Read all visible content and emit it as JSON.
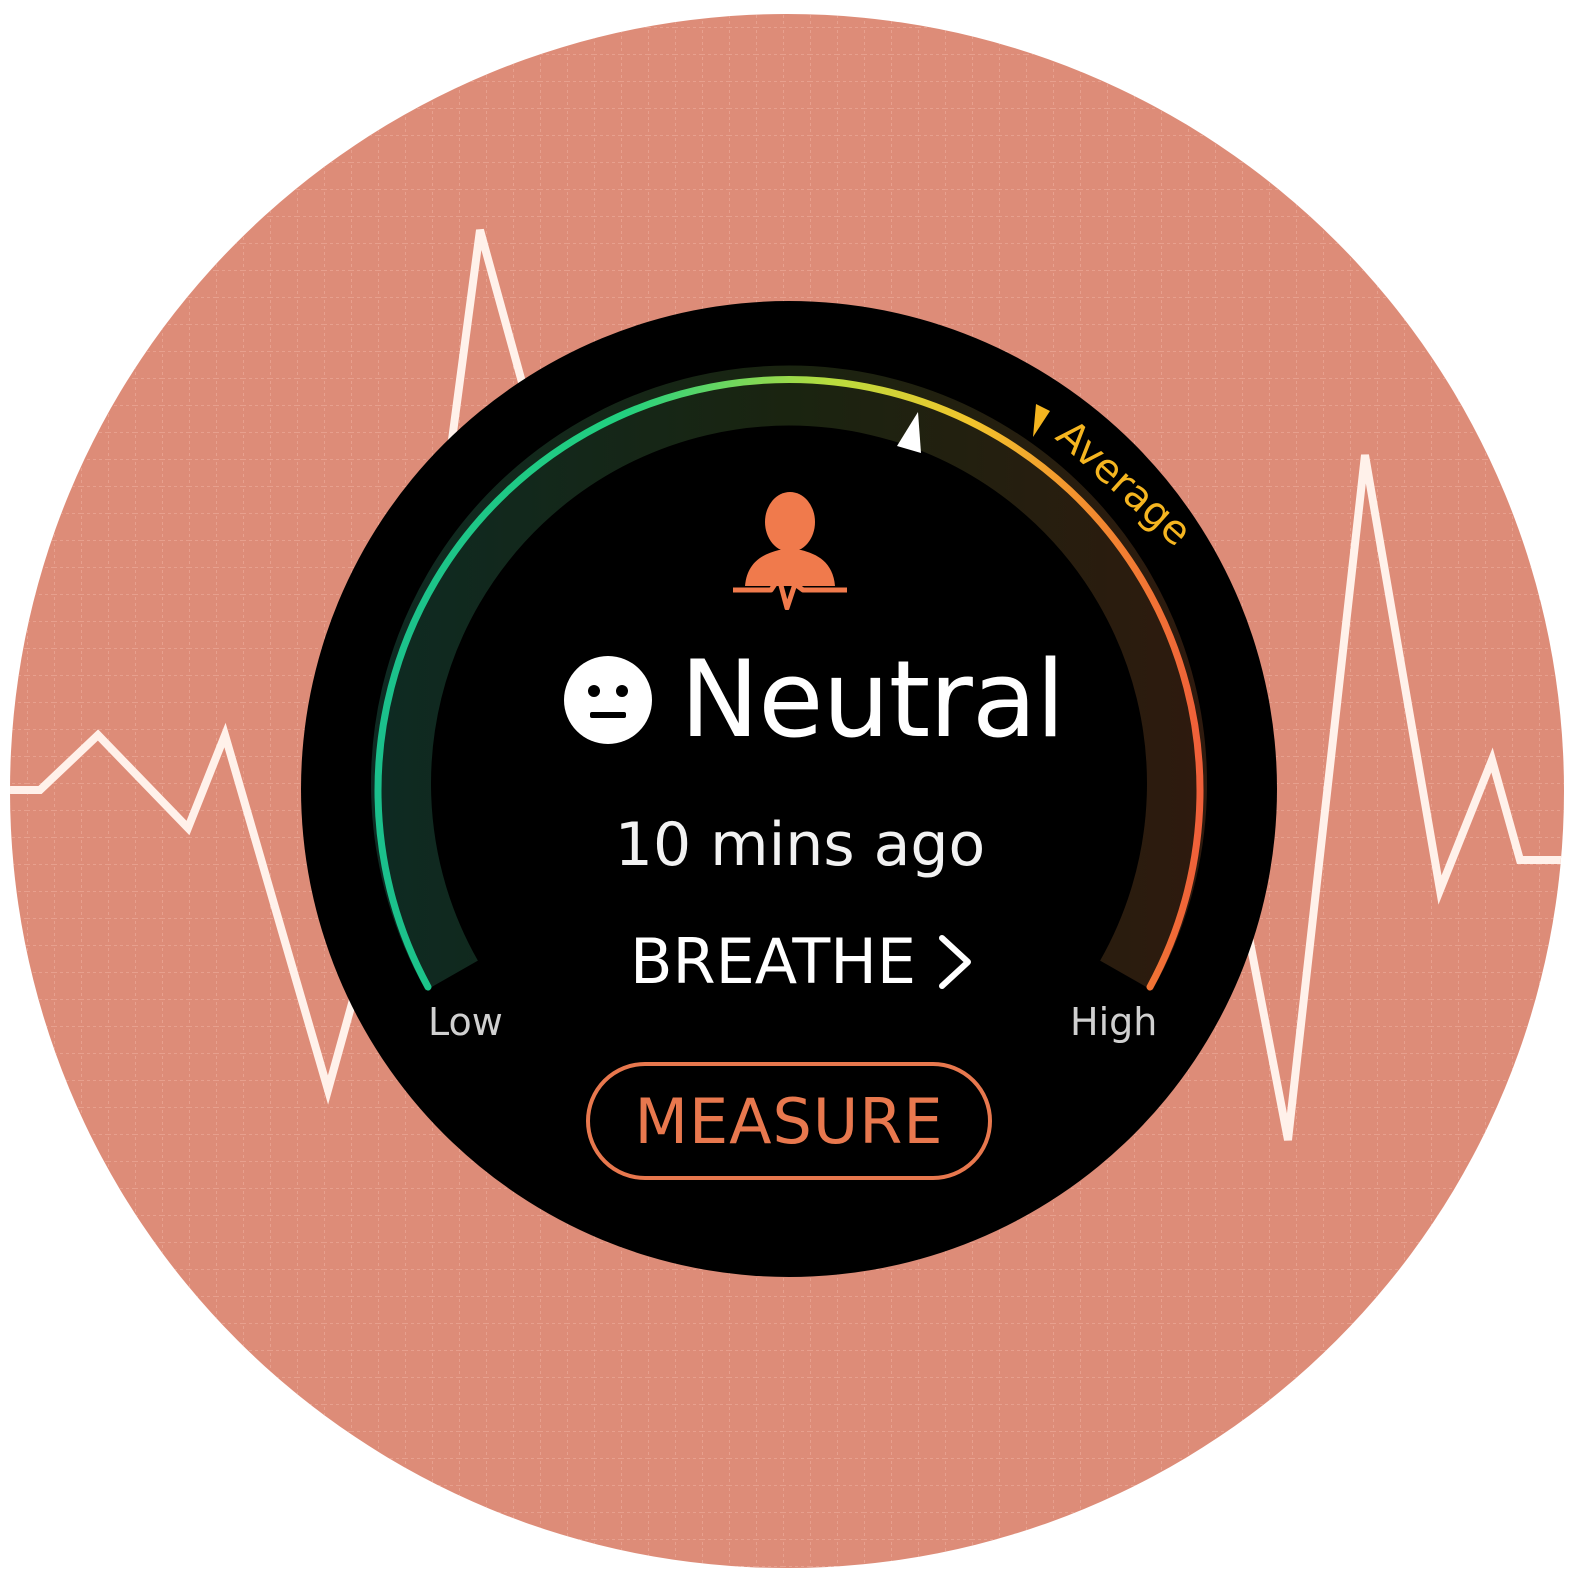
{
  "app": {
    "status": {
      "label": "Neutral",
      "icon": "neutral-face-icon"
    },
    "last_measured": "10 mins ago",
    "breathe": {
      "label": "BREATHE",
      "icon": "chevron-right-icon"
    },
    "gauge": {
      "low_label": "Low",
      "high_label": "High",
      "average_label": "Average",
      "current_level": 0.6,
      "average_level": 0.77,
      "colors": {
        "low": "#1ed09a",
        "mid": "#c8e03a",
        "average": "#f5b520",
        "high": "#f06a3a"
      }
    },
    "measure_button": {
      "label": "MEASURE"
    },
    "header_icon": "stress-person-icon",
    "colors": {
      "background": "#dd8c78",
      "accent": "#e8784e",
      "watch_face": "#000000",
      "line": "#fff1ea"
    }
  }
}
